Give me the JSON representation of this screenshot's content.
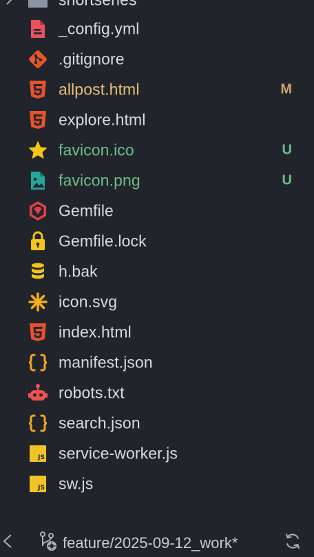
{
  "explorer": {
    "folder_partial": {
      "label": "shortseries"
    },
    "files": [
      {
        "label": "_config.yml",
        "icon": "yaml-file-icon",
        "status": "normal",
        "badge": ""
      },
      {
        "label": ".gitignore",
        "icon": "git-icon",
        "status": "normal",
        "badge": ""
      },
      {
        "label": "allpost.html",
        "icon": "html5-icon",
        "status": "modified",
        "badge": "M"
      },
      {
        "label": "explore.html",
        "icon": "html5-icon",
        "status": "normal",
        "badge": ""
      },
      {
        "label": "favicon.ico",
        "icon": "star-icon",
        "status": "untracked",
        "badge": "U"
      },
      {
        "label": "favicon.png",
        "icon": "image-file-icon",
        "status": "untracked",
        "badge": "U"
      },
      {
        "label": "Gemfile",
        "icon": "ruby-gem-icon",
        "status": "normal",
        "badge": ""
      },
      {
        "label": "Gemfile.lock",
        "icon": "lock-icon",
        "status": "normal",
        "badge": ""
      },
      {
        "label": "h.bak",
        "icon": "database-icon",
        "status": "normal",
        "badge": ""
      },
      {
        "label": "icon.svg",
        "icon": "svg-asterisk-icon",
        "status": "normal",
        "badge": ""
      },
      {
        "label": "index.html",
        "icon": "html5-icon",
        "status": "normal",
        "badge": ""
      },
      {
        "label": "manifest.json",
        "icon": "json-braces-icon",
        "status": "normal",
        "badge": ""
      },
      {
        "label": "robots.txt",
        "icon": "robot-icon",
        "status": "normal",
        "badge": ""
      },
      {
        "label": "search.json",
        "icon": "json-braces-icon",
        "status": "normal",
        "badge": ""
      },
      {
        "label": "service-worker.js",
        "icon": "javascript-icon",
        "status": "normal",
        "badge": ""
      },
      {
        "label": "sw.js",
        "icon": "javascript-icon",
        "status": "normal",
        "badge": ""
      }
    ]
  },
  "statusbar": {
    "branch": "feature/2025-09-12_work*",
    "back_icon": "chevron-left-icon",
    "branch_icon": "git-branch-icon",
    "sync_icon": "sync-icon"
  },
  "colors": {
    "background": "#21252b",
    "text": "#d7dae0",
    "modified": "#e5c07b",
    "untracked": "#6dbd8c"
  }
}
